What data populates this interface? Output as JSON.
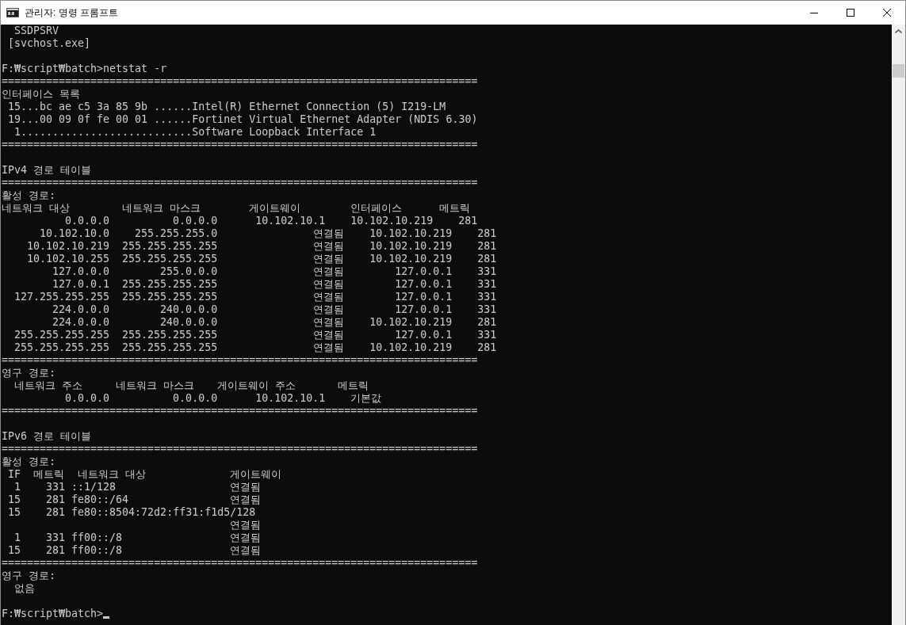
{
  "window": {
    "title": "관리자: 명령 프롬프트"
  },
  "console": {
    "blocks": [
      {
        "kind": "line",
        "text": "  SSDPSRV"
      },
      {
        "kind": "line",
        "text": " [svchost.exe]"
      },
      {
        "kind": "blank"
      },
      {
        "kind": "line",
        "text": "F:₩script₩batch>netstat -r"
      },
      {
        "kind": "line",
        "text": "==========================================================================="
      },
      {
        "kind": "line",
        "text": "인터페이스 목록"
      },
      {
        "kind": "line",
        "text": " 15...bc ae c5 3a 85 9b ......Intel(R) Ethernet Connection (5) I219-LM"
      },
      {
        "kind": "line",
        "text": " 19...00 09 0f fe 00 01 ......Fortinet Virtual Ethernet Adapter (NDIS 6.30)"
      },
      {
        "kind": "line",
        "text": "  1...........................Software Loopback Interface 1"
      },
      {
        "kind": "line",
        "text": "==========================================================================="
      },
      {
        "kind": "blank"
      },
      {
        "kind": "line",
        "text": "IPv4 경로 테이블"
      },
      {
        "kind": "line",
        "text": "==========================================================================="
      },
      {
        "kind": "line",
        "text": "활성 경로:"
      },
      {
        "kind": "ipv4_active",
        "header": [
          "네트워크 대상",
          "네트워크 마스크",
          "게이트웨이",
          "인터페이스",
          "메트릭"
        ],
        "rows": [
          [
            "0.0.0.0",
            "0.0.0.0",
            "10.102.10.1",
            "10.102.10.219",
            "281"
          ],
          [
            "10.102.10.0",
            "255.255.255.0",
            "연결됨",
            "10.102.10.219",
            "281"
          ],
          [
            "10.102.10.219",
            "255.255.255.255",
            "연결됨",
            "10.102.10.219",
            "281"
          ],
          [
            "10.102.10.255",
            "255.255.255.255",
            "연결됨",
            "10.102.10.219",
            "281"
          ],
          [
            "127.0.0.0",
            "255.0.0.0",
            "연결됨",
            "127.0.0.1",
            "331"
          ],
          [
            "127.0.0.1",
            "255.255.255.255",
            "연결됨",
            "127.0.0.1",
            "331"
          ],
          [
            "127.255.255.255",
            "255.255.255.255",
            "연결됨",
            "127.0.0.1",
            "331"
          ],
          [
            "224.0.0.0",
            "240.0.0.0",
            "연결됨",
            "127.0.0.1",
            "331"
          ],
          [
            "224.0.0.0",
            "240.0.0.0",
            "연결됨",
            "10.102.10.219",
            "281"
          ],
          [
            "255.255.255.255",
            "255.255.255.255",
            "연결됨",
            "127.0.0.1",
            "331"
          ],
          [
            "255.255.255.255",
            "255.255.255.255",
            "연결됨",
            "10.102.10.219",
            "281"
          ]
        ]
      },
      {
        "kind": "line",
        "text": "==========================================================================="
      },
      {
        "kind": "line",
        "text": "영구 경로:"
      },
      {
        "kind": "ipv4_persistent",
        "header": [
          "네트워크 주소",
          "네트워크 마스크",
          "게이트웨이 주소",
          "메트릭"
        ],
        "rows": [
          [
            "0.0.0.0",
            "0.0.0.0",
            "10.102.10.1",
            "기본값"
          ]
        ]
      },
      {
        "kind": "line",
        "text": "==========================================================================="
      },
      {
        "kind": "blank"
      },
      {
        "kind": "line",
        "text": "IPv6 경로 테이블"
      },
      {
        "kind": "line",
        "text": "==========================================================================="
      },
      {
        "kind": "line",
        "text": "활성 경로:"
      },
      {
        "kind": "ipv6_active",
        "header": [
          "IF",
          "메트릭",
          "네트워크 대상",
          "게이트웨이"
        ],
        "rows": [
          [
            "1",
            "331",
            "::1/128",
            "연결됨"
          ],
          [
            "15",
            "281",
            "fe80::/64",
            "연결됨"
          ],
          [
            "15",
            "281",
            "fe80::8504:72d2:ff31:f1d5/128",
            "연결됨"
          ],
          [
            "1",
            "331",
            "ff00::/8",
            "연결됨"
          ],
          [
            "15",
            "281",
            "ff00::/8",
            "연결됨"
          ]
        ]
      },
      {
        "kind": "line",
        "text": "==========================================================================="
      },
      {
        "kind": "line",
        "text": "영구 경로:"
      },
      {
        "kind": "line",
        "text": "  없음"
      },
      {
        "kind": "blank"
      },
      {
        "kind": "prompt",
        "text": "F:₩script₩batch>",
        "cursor": true
      }
    ]
  }
}
